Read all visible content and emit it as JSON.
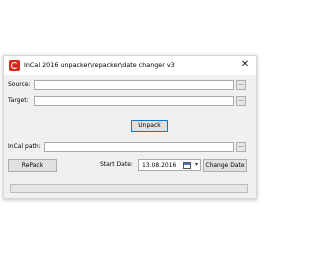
{
  "window": {
    "title": "InCal 2016 unpacker\\repacker\\date changer v3",
    "close_symbol": "✕"
  },
  "fields": {
    "source_label": "Source:",
    "source_value": "",
    "target_label": "Target:",
    "target_value": "",
    "incal_path_label": "InCal path:",
    "incal_path_value": "",
    "browse_label": "..."
  },
  "buttons": {
    "unpack": "Unpack",
    "repack": "RePack",
    "change_date": "Change Date"
  },
  "date": {
    "label": "Start Date:",
    "value": "13.08.2016",
    "dropdown_symbol": "▾"
  },
  "progress": {
    "value": 0
  },
  "icons": {
    "app": "incal-app-icon",
    "calendar": "calendar-icon",
    "close": "close-icon"
  },
  "colors": {
    "app_icon": "#d42a20",
    "focus_border": "#0078d7"
  }
}
